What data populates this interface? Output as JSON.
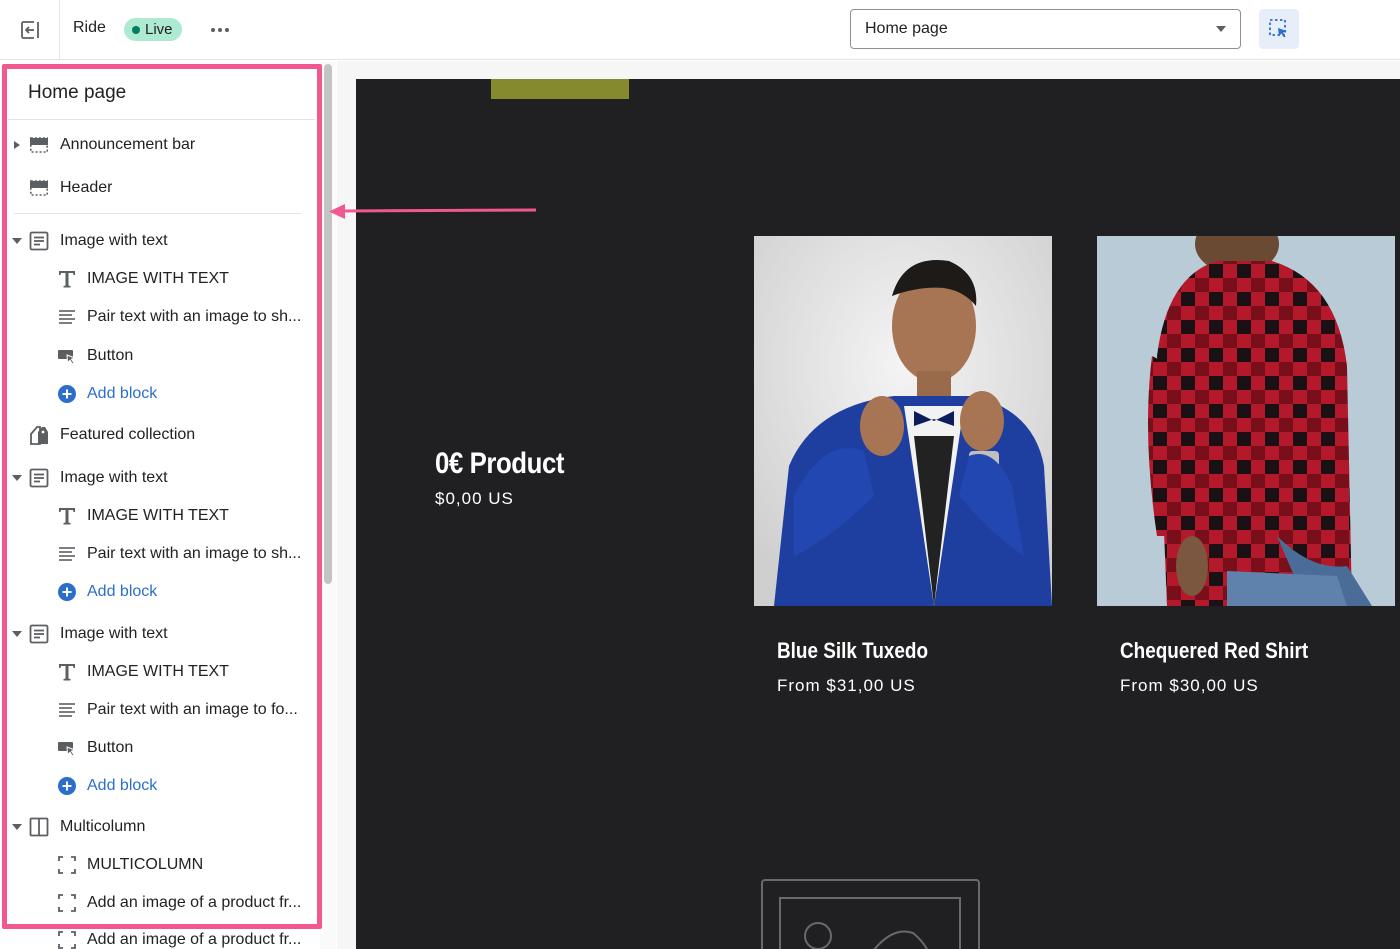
{
  "topbar": {
    "theme_name": "Ride",
    "status_badge": "Live",
    "page_selector_value": "Home page"
  },
  "sidebar": {
    "title": "Home page",
    "header_group": [
      {
        "label": "Announcement bar",
        "icon": "layout-bar-icon",
        "collapsed": true
      },
      {
        "label": "Header",
        "icon": "layout-bar-icon"
      }
    ],
    "template_sections": [
      {
        "label": "Image with text",
        "icon": "text-block-icon",
        "blocks": [
          {
            "label": "IMAGE WITH TEXT",
            "icon": "text-type-icon"
          },
          {
            "label": "Pair text with an image to sh...",
            "icon": "paragraph-icon"
          },
          {
            "label": "Button",
            "icon": "button-icon"
          }
        ],
        "add_block_label": "Add block"
      },
      {
        "label": "Featured collection",
        "icon": "tags-icon",
        "blocks": []
      },
      {
        "label": "Image with text",
        "icon": "text-block-icon",
        "blocks": [
          {
            "label": "IMAGE WITH TEXT",
            "icon": "text-type-icon"
          },
          {
            "label": "Pair text with an image to sh...",
            "icon": "paragraph-icon"
          }
        ],
        "add_block_label": "Add block"
      },
      {
        "label": "Image with text",
        "icon": "text-block-icon",
        "blocks": [
          {
            "label": "IMAGE WITH TEXT",
            "icon": "text-type-icon"
          },
          {
            "label": "Pair text with an image to fo...",
            "icon": "paragraph-icon"
          },
          {
            "label": "Button",
            "icon": "button-icon"
          }
        ],
        "add_block_label": "Add block"
      },
      {
        "label": "Multicolumn",
        "icon": "columns-icon",
        "blocks": [
          {
            "label": "MULTICOLUMN",
            "icon": "frame-icon"
          },
          {
            "label": "Add an image of a product fr...",
            "icon": "frame-icon"
          },
          {
            "label": "Add an image of a product fr...",
            "icon": "frame-icon"
          }
        ]
      }
    ]
  },
  "preview": {
    "hero_product": {
      "title": "0€ Product",
      "price": "$0,00 US"
    },
    "products": [
      {
        "title": "Blue Silk Tuxedo",
        "price": "From $31,00 US"
      },
      {
        "title": "Chequered Red Shirt",
        "price": "From $30,00 US"
      }
    ]
  },
  "colors": {
    "highlight": "#f0588f",
    "link": "#2c6ecb",
    "live_badge": "#aee9d1",
    "preview_background": "#202023",
    "accent_bar": "#858a2e"
  }
}
